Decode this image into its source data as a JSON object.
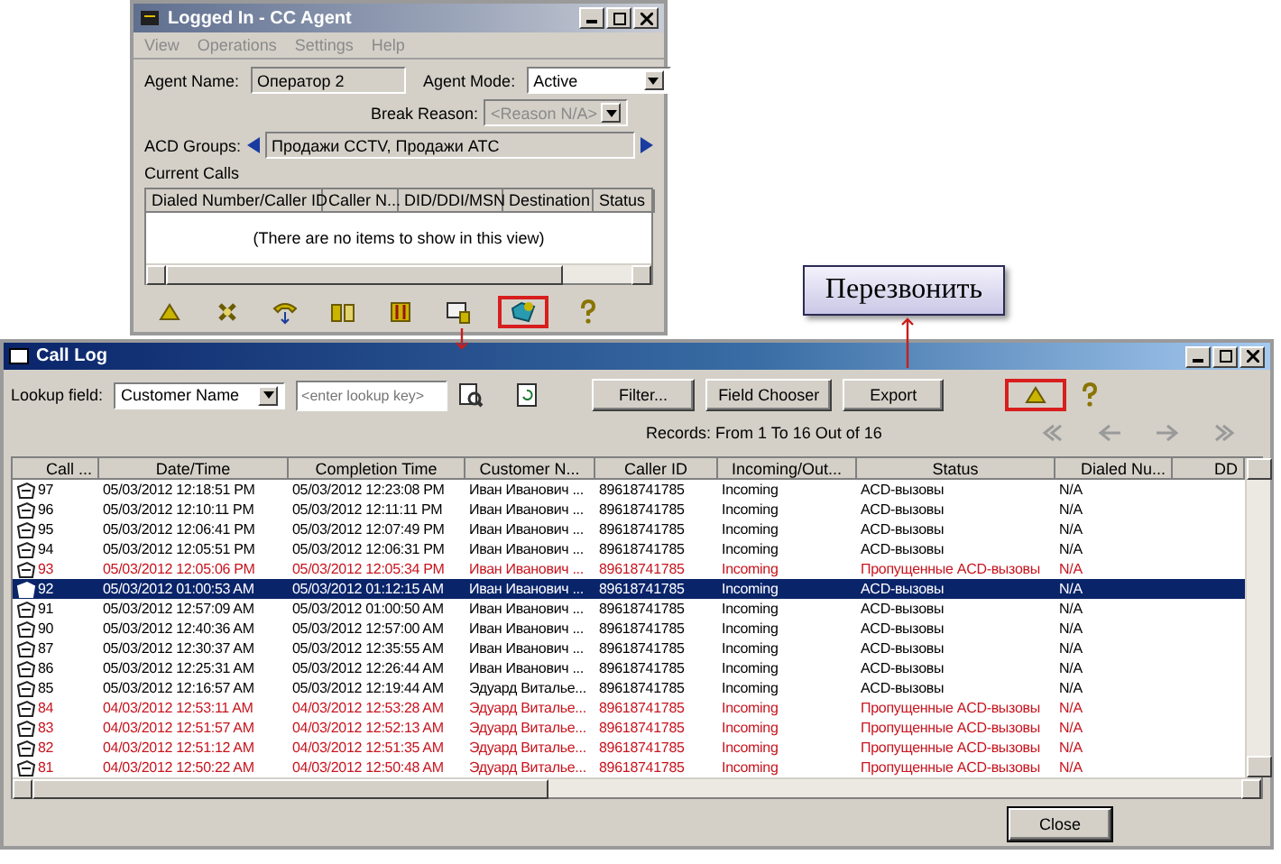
{
  "agent_window": {
    "title": "Logged In - CC Agent",
    "menu": [
      "View",
      "Operations",
      "Settings",
      "Help"
    ],
    "agent_name": {
      "label": "Agent Name:",
      "value": "Оператор 2"
    },
    "agent_mode": {
      "label": "Agent Mode:",
      "value": "Active",
      "disabled": false
    },
    "break_reason": {
      "label": "Break Reason:",
      "value": "<Reason N/A>",
      "disabled": true
    },
    "acd_groups": {
      "label": "ACD Groups:",
      "value": "Продажи CCTV, Продажи ATC"
    },
    "current_calls": {
      "label": "Current Calls",
      "columns": [
        "Dialed Number/Caller ID",
        "Caller N...",
        "DID/DDI/MSN",
        "Destination",
        "Status"
      ],
      "empty_message": "(There are no items to show in this view)"
    },
    "toolbar": [
      {
        "highlighted": false
      },
      {
        "highlighted": false
      },
      {
        "highlighted": false
      },
      {
        "highlighted": false
      },
      {
        "highlighted": false
      },
      {
        "highlighted": false
      },
      {
        "highlighted": true
      },
      {
        "highlighted": false
      }
    ]
  },
  "callout": {
    "text": "Перезвонить"
  },
  "call_log": {
    "title": "Call Log",
    "lookup": {
      "label": "Lookup field:",
      "value": "Customer Name",
      "placeholder": "<enter lookup key>"
    },
    "buttons": [
      "Filter...",
      "Field Chooser",
      "Export"
    ],
    "callback_highlighted": true,
    "records": "Records: From 1 To 16 Out of 16",
    "columns": [
      "Call ...",
      "Date/Time",
      "Completion Time",
      "Customer N...",
      "Caller ID",
      "Incoming/Out...",
      "Status",
      "Dialed Nu...",
      "DD"
    ],
    "rows": [
      {
        "call": "97",
        "date": "05/03/2012 12:18:51 PM",
        "completion": "05/03/2012 12:23:08 PM",
        "customer": "Иван Иванович ...",
        "caller_id": "89618741785",
        "direction": "Incoming",
        "status": "ACD-вызовы",
        "dialed": "N/A",
        "missed": false,
        "selected": false
      },
      {
        "call": "96",
        "date": "05/03/2012 12:10:11 PM",
        "completion": "05/03/2012 12:11:11 PM",
        "customer": "Иван Иванович ...",
        "caller_id": "89618741785",
        "direction": "Incoming",
        "status": "ACD-вызовы",
        "dialed": "N/A",
        "missed": false,
        "selected": false
      },
      {
        "call": "95",
        "date": "05/03/2012 12:06:41 PM",
        "completion": "05/03/2012 12:07:49 PM",
        "customer": "Иван Иванович ...",
        "caller_id": "89618741785",
        "direction": "Incoming",
        "status": "ACD-вызовы",
        "dialed": "N/A",
        "missed": false,
        "selected": false
      },
      {
        "call": "94",
        "date": "05/03/2012 12:05:51 PM",
        "completion": "05/03/2012 12:06:31 PM",
        "customer": "Иван Иванович ...",
        "caller_id": "89618741785",
        "direction": "Incoming",
        "status": "ACD-вызовы",
        "dialed": "N/A",
        "missed": false,
        "selected": false
      },
      {
        "call": "93",
        "date": "05/03/2012 12:05:06 PM",
        "completion": "05/03/2012 12:05:34 PM",
        "customer": "Иван Иванович ...",
        "caller_id": "89618741785",
        "direction": "Incoming",
        "status": "Пропущенные ACD-вызовы",
        "dialed": "N/A",
        "missed": true,
        "selected": false
      },
      {
        "call": "92",
        "date": "05/03/2012 01:00:53 AM",
        "completion": "05/03/2012 01:12:15 AM",
        "customer": "Иван Иванович ...",
        "caller_id": "89618741785",
        "direction": "Incoming",
        "status": "ACD-вызовы",
        "dialed": "N/A",
        "missed": false,
        "selected": true
      },
      {
        "call": "91",
        "date": "05/03/2012 12:57:09 AM",
        "completion": "05/03/2012 01:00:50 AM",
        "customer": "Иван Иванович ...",
        "caller_id": "89618741785",
        "direction": "Incoming",
        "status": "ACD-вызовы",
        "dialed": "N/A",
        "missed": false,
        "selected": false
      },
      {
        "call": "90",
        "date": "05/03/2012 12:40:36 AM",
        "completion": "05/03/2012 12:57:00 AM",
        "customer": "Иван Иванович ...",
        "caller_id": "89618741785",
        "direction": "Incoming",
        "status": "ACD-вызовы",
        "dialed": "N/A",
        "missed": false,
        "selected": false
      },
      {
        "call": "87",
        "date": "05/03/2012 12:30:37 AM",
        "completion": "05/03/2012 12:35:55 AM",
        "customer": "Иван Иванович ...",
        "caller_id": "89618741785",
        "direction": "Incoming",
        "status": "ACD-вызовы",
        "dialed": "N/A",
        "missed": false,
        "selected": false
      },
      {
        "call": "86",
        "date": "05/03/2012 12:25:31 AM",
        "completion": "05/03/2012 12:26:44 AM",
        "customer": "Иван Иванович ...",
        "caller_id": "89618741785",
        "direction": "Incoming",
        "status": "ACD-вызовы",
        "dialed": "N/A",
        "missed": false,
        "selected": false
      },
      {
        "call": "85",
        "date": "05/03/2012 12:16:57 AM",
        "completion": "05/03/2012 12:19:44 AM",
        "customer": "Эдуард Виталье...",
        "caller_id": "89618741785",
        "direction": "Incoming",
        "status": "ACD-вызовы",
        "dialed": "N/A",
        "missed": false,
        "selected": false
      },
      {
        "call": "84",
        "date": "04/03/2012 12:53:11 AM",
        "completion": "04/03/2012 12:53:28 AM",
        "customer": "Эдуард Виталье...",
        "caller_id": "89618741785",
        "direction": "Incoming",
        "status": "Пропущенные ACD-вызовы",
        "dialed": "N/A",
        "missed": true,
        "selected": false
      },
      {
        "call": "83",
        "date": "04/03/2012 12:51:57 AM",
        "completion": "04/03/2012 12:52:13 AM",
        "customer": "Эдуард Виталье...",
        "caller_id": "89618741785",
        "direction": "Incoming",
        "status": "Пропущенные ACD-вызовы",
        "dialed": "N/A",
        "missed": true,
        "selected": false
      },
      {
        "call": "82",
        "date": "04/03/2012 12:51:12 AM",
        "completion": "04/03/2012 12:51:35 AM",
        "customer": "Эдуард Виталье...",
        "caller_id": "89618741785",
        "direction": "Incoming",
        "status": "Пропущенные ACD-вызовы",
        "dialed": "N/A",
        "missed": true,
        "selected": false
      },
      {
        "call": "81",
        "date": "04/03/2012 12:50:22 AM",
        "completion": "04/03/2012 12:50:48 AM",
        "customer": "Эдуард Виталье...",
        "caller_id": "89618741785",
        "direction": "Incoming",
        "status": "Пропущенные ACD-вызовы",
        "dialed": "N/A",
        "missed": true,
        "selected": false
      }
    ],
    "close": "Close"
  }
}
